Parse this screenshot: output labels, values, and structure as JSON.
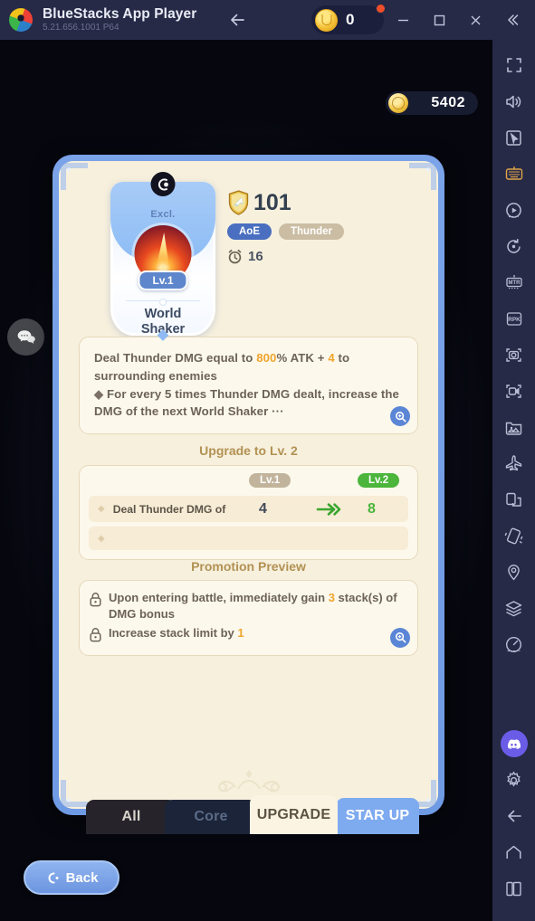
{
  "titlebar": {
    "app_name": "BlueStacks App Player",
    "version": "5.21.656.1001  P64",
    "coin_count": "0",
    "back_icon": "arrow-left-icon",
    "minimize_icon": "minimize-icon",
    "maximize_icon": "maximize-icon",
    "close_icon": "close-icon",
    "collapse_icon": "chevron-double-left-icon"
  },
  "sidebar": {
    "items": [
      {
        "name": "fullscreen-icon"
      },
      {
        "name": "volume-icon"
      },
      {
        "name": "cursor-pointer-icon"
      },
      {
        "name": "keyboard-controls-icon"
      },
      {
        "name": "macro-play-icon"
      },
      {
        "name": "rotate-icon"
      },
      {
        "name": "mtr-mode-icon"
      },
      {
        "name": "rpk-icon"
      },
      {
        "name": "screenshot-icon"
      },
      {
        "name": "record-video-icon"
      },
      {
        "name": "media-gallery-icon"
      },
      {
        "name": "airplane-icon"
      },
      {
        "name": "multi-instance-icon"
      },
      {
        "name": "shake-device-icon"
      },
      {
        "name": "location-icon"
      },
      {
        "name": "layers-icon"
      },
      {
        "name": "performance-icon"
      }
    ],
    "bottom_items": [
      {
        "name": "discord-icon"
      },
      {
        "name": "settings-gear-icon"
      },
      {
        "name": "android-back-icon"
      },
      {
        "name": "android-home-icon"
      },
      {
        "name": "android-recents-icon"
      }
    ]
  },
  "game": {
    "currency": {
      "value": "5402",
      "icon": "gold-coin-icon"
    },
    "chat_button": {
      "icon": "chat-bubbles-icon"
    },
    "nav_prev": {
      "icon": "chevron-left-icon"
    },
    "nav_next": {
      "icon": "chevron-right-icon"
    },
    "skill": {
      "rarity_mark": "C",
      "exclusive_label": "Excl.",
      "level_badge": "Lv.1",
      "name_line1": "World",
      "name_line2": "Shaker",
      "power_value": "101",
      "power_icon": "shield-icon",
      "tags": [
        "AoE",
        "Thunder"
      ],
      "cooldown_icon": "cooldown-icon",
      "cooldown_value": "16"
    },
    "description": {
      "line1_a": "Deal Thunder DMG equal to ",
      "line1_hl1": "800",
      "line1_b": "% ATK + ",
      "line1_hl2": "4",
      "line1_c": " to surrounding enemies",
      "line2": "For every 5 times Thunder DMG dealt, increase the DMG of the next World Shaker ···",
      "bullet": "◆",
      "expand_icon": "magnifier-icon"
    },
    "upgrade": {
      "title": "Upgrade to Lv. 2",
      "col_from": "Lv.1",
      "col_to": "Lv.2",
      "rows": [
        {
          "label": "Deal Thunder DMG of",
          "from": "4",
          "to": "8"
        },
        {
          "label": "",
          "from": "",
          "to": ""
        }
      ],
      "arrow_icon": "arrow-right-icon"
    },
    "promotion": {
      "title": "Promotion Preview",
      "items": [
        {
          "icon": "lock-icon",
          "text_a": "Upon entering battle, immediately gain ",
          "hl": "3",
          "text_b": " stack(s) of DMG bonus"
        },
        {
          "icon": "lock-icon",
          "text_a": "Increase stack limit by ",
          "hl": "1",
          "text_b": ""
        }
      ],
      "expand_icon": "magnifier-icon"
    },
    "tabs": [
      {
        "label": "All",
        "name": "tab-all"
      },
      {
        "label": "Core",
        "name": "tab-core"
      },
      {
        "label": "UPGRADE",
        "name": "tab-upgrade"
      },
      {
        "label": "STAR UP",
        "name": "tab-star-up"
      }
    ],
    "back_button": {
      "label": "Back",
      "icon": "back-chevron-icon"
    }
  },
  "colors": {
    "accent_blue": "#6f95dd",
    "gold": "#f0a52c",
    "green": "#4bb53c",
    "card_bg": "#f7f0dd",
    "titlebar": "#262a47"
  }
}
